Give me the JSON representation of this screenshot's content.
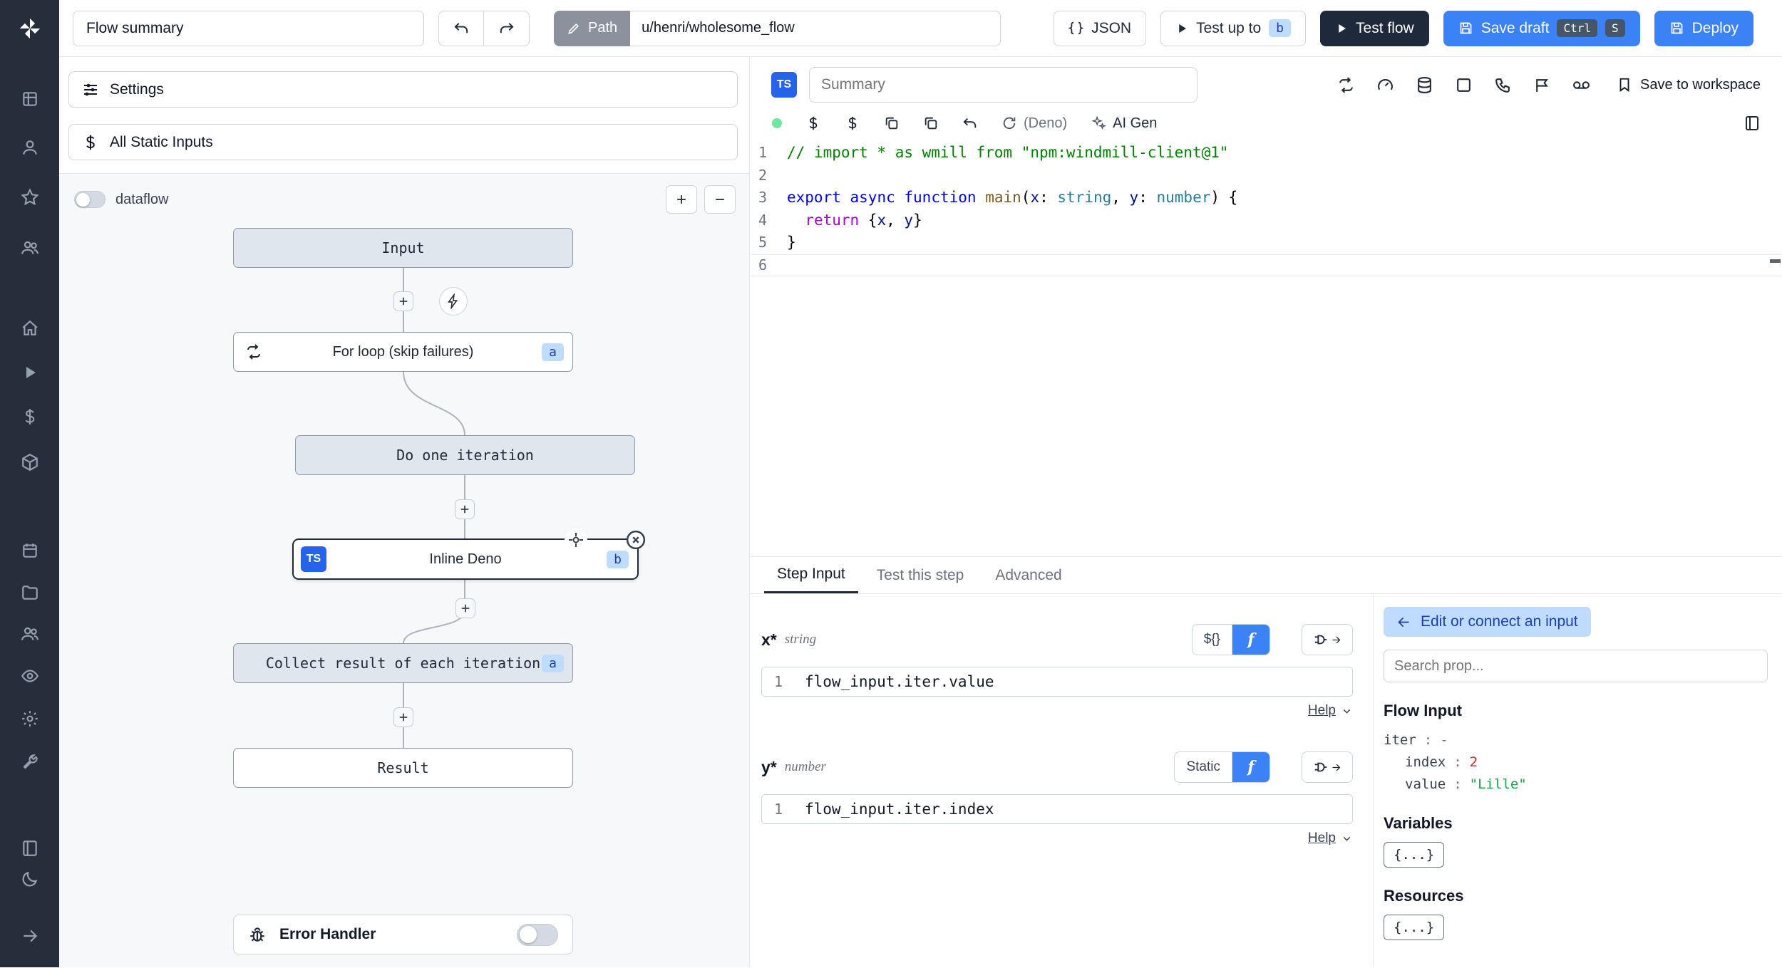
{
  "topbar": {
    "flow_summary": "Flow summary",
    "path_label": "Path",
    "path_value": "u/henri/wholesome_flow",
    "json_label": "JSON",
    "test_up_to_label": "Test up to",
    "test_up_to_badge": "b",
    "test_flow_label": "Test flow",
    "save_draft_label": "Save draft",
    "shortcut_ctrl": "Ctrl",
    "shortcut_s": "S",
    "deploy_label": "Deploy"
  },
  "flow": {
    "settings_label": "Settings",
    "static_inputs_label": "All Static Inputs",
    "dataflow_label": "dataflow",
    "zoom_in": "+",
    "zoom_out": "−",
    "nodes": [
      {
        "label": "Input"
      },
      {
        "label": "For loop (skip failures)",
        "badge": "a"
      },
      {
        "label": "Do one iteration"
      },
      {
        "label": "Inline Deno",
        "badge": "b",
        "lang": "TS"
      },
      {
        "label": "Collect result of each iteration",
        "badge": "a"
      },
      {
        "label": "Result"
      }
    ],
    "error_handler_label": "Error Handler"
  },
  "editor": {
    "lang_badge": "TS",
    "summary_placeholder": "Summary",
    "save_to_workspace_label": "Save to workspace",
    "runtime_label": "(Deno)",
    "ai_gen_label": "AI Gen",
    "code": [
      {
        "n": "1",
        "tokens": [
          [
            "// import * as wmill from \"npm:windmill-client@1\"",
            "comment"
          ]
        ]
      },
      {
        "n": "2",
        "tokens": []
      },
      {
        "n": "3",
        "tokens": [
          [
            "export",
            "kw"
          ],
          [
            " ",
            "plain"
          ],
          [
            "async",
            "kw"
          ],
          [
            " ",
            "plain"
          ],
          [
            "function",
            "kw"
          ],
          [
            " ",
            "plain"
          ],
          [
            "main",
            "fn"
          ],
          [
            "(",
            "plain"
          ],
          [
            "x",
            "param"
          ],
          [
            ": ",
            "plain"
          ],
          [
            "string",
            "type"
          ],
          [
            ", ",
            "plain"
          ],
          [
            "y",
            "param"
          ],
          [
            ": ",
            "plain"
          ],
          [
            "number",
            "type"
          ],
          [
            ") {",
            "plain"
          ]
        ]
      },
      {
        "n": "4",
        "tokens": [
          [
            "  ",
            "plain"
          ],
          [
            "return",
            "ctrl"
          ],
          [
            " {",
            "plain"
          ],
          [
            "x",
            "param"
          ],
          [
            ", ",
            "plain"
          ],
          [
            "y",
            "param"
          ],
          [
            "}",
            "plain"
          ]
        ]
      },
      {
        "n": "5",
        "tokens": [
          [
            "}",
            "plain"
          ]
        ]
      },
      {
        "n": "6",
        "tokens": [],
        "current": true
      }
    ]
  },
  "step": {
    "tabs": [
      {
        "label": "Step Input"
      },
      {
        "label": "Test this step"
      },
      {
        "label": "Advanced"
      }
    ],
    "inputs": [
      {
        "name": "x",
        "star": "*",
        "type": "string",
        "seg_left": "${}",
        "seg_right": "f",
        "line_n": "1",
        "expr": "flow_input.iter.value",
        "help": "Help"
      },
      {
        "name": "y",
        "star": "*",
        "type": "number",
        "seg_left": "Static",
        "seg_right": "f",
        "line_n": "1",
        "expr": "flow_input.iter.index",
        "help": "Help"
      }
    ]
  },
  "props": {
    "edit_connect_label": "Edit or connect an input",
    "search_placeholder": "Search prop...",
    "flow_input_title": "Flow Input",
    "tree": [
      {
        "key": "iter",
        "sep": ":",
        "value": "-",
        "kind": "plain",
        "depth": 0
      },
      {
        "key": "index",
        "sep": ":",
        "value": "2",
        "kind": "number",
        "depth": 1
      },
      {
        "key": "value",
        "sep": ":",
        "value": "\"Lille\"",
        "kind": "string",
        "depth": 1
      }
    ],
    "variables_title": "Variables",
    "variables_chip": "{...}",
    "resources_title": "Resources",
    "resources_chip": "{...}"
  }
}
